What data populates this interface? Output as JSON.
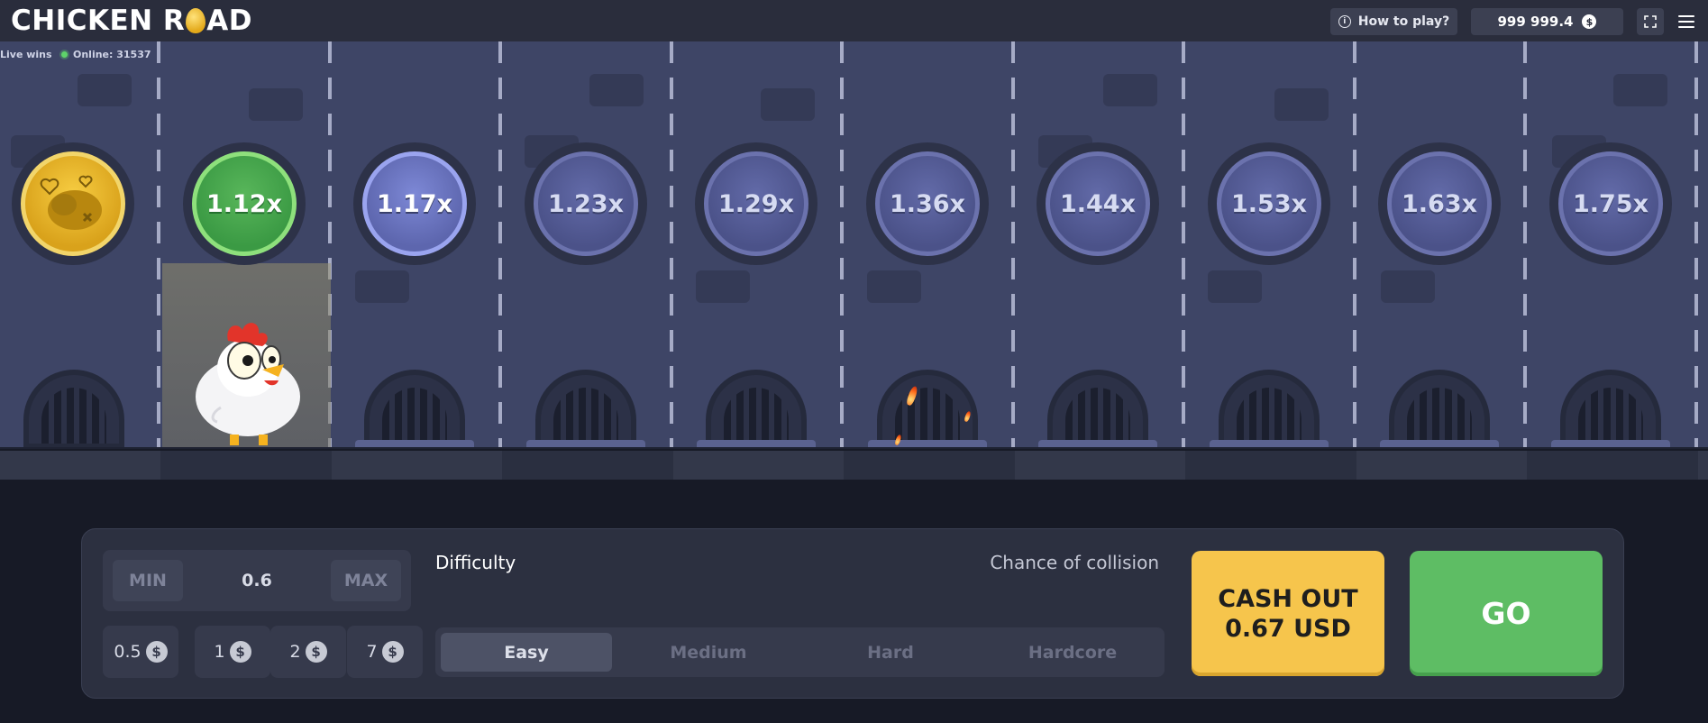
{
  "header": {
    "logo_left": "CHICKEN R",
    "logo_right": "AD",
    "how_to_play": "How to play?",
    "balance": "999 999.4",
    "currency_symbol": "$"
  },
  "game": {
    "live_wins": "Live wins",
    "online": "Online: 31537",
    "multipliers": [
      "1.12x",
      "1.17x",
      "1.23x",
      "1.29x",
      "1.36x",
      "1.44x",
      "1.53x",
      "1.63x",
      "1.75x"
    ]
  },
  "controls": {
    "min_label": "MIN",
    "max_label": "MAX",
    "bet_value": "0.6",
    "quick_bets": [
      "0.5",
      "1",
      "2",
      "7"
    ],
    "difficulty_label": "Difficulty",
    "chance_label": "Chance of collision",
    "difficulties": [
      "Easy",
      "Medium",
      "Hard",
      "Hardcore"
    ],
    "selected_difficulty": "Easy",
    "cash_out_line1": "CASH OUT",
    "cash_out_line2": "0.67 USD",
    "go_label": "GO"
  },
  "colors": {
    "accent_green": "#5ebd64",
    "accent_yellow": "#f6c54c",
    "lane_bg": "#3e4566",
    "panel_bg": "#2c3040"
  },
  "icons": {
    "how_to_play": "info-icon",
    "fullscreen": "fullscreen-icon",
    "menu": "hamburger-menu-icon",
    "coin": "dollar-coin-icon"
  }
}
